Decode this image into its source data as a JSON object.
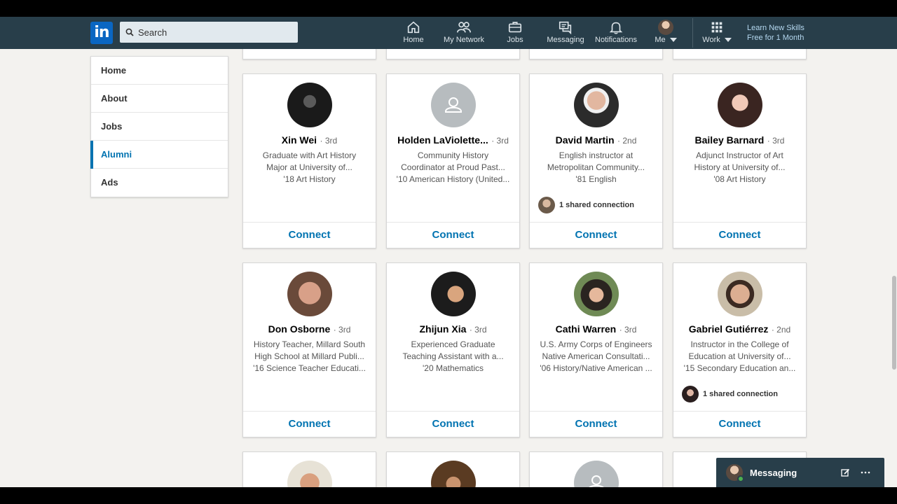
{
  "nav": {
    "search_placeholder": "Search",
    "items": [
      {
        "label": "Home",
        "icon": "home-icon"
      },
      {
        "label": "My Network",
        "icon": "network-icon"
      },
      {
        "label": "Jobs",
        "icon": "briefcase-icon"
      },
      {
        "label": "Messaging",
        "icon": "messaging-icon"
      },
      {
        "label": "Notifications",
        "icon": "bell-icon"
      },
      {
        "label": "Me",
        "icon": "avatar"
      },
      {
        "label": "Work",
        "icon": "grid-icon"
      }
    ],
    "promo_line1": "Learn New Skills",
    "promo_line2": "Free for 1 Month"
  },
  "sidebar": {
    "items": [
      {
        "label": "Home"
      },
      {
        "label": "About"
      },
      {
        "label": "Jobs"
      },
      {
        "label": "Alumni",
        "active": true
      },
      {
        "label": "Ads"
      }
    ]
  },
  "cards": [
    {
      "name": "Xin Wei",
      "degree": "· 3rd",
      "line1": "Graduate with Art History",
      "line2": "Major at University of...",
      "line3": "'18 Art History",
      "shared": "",
      "button": "Connect"
    },
    {
      "name": "Holden LaViolette...",
      "degree": "· 3rd",
      "line1": "Community History",
      "line2": "Coordinator at Proud Past...",
      "line3": "'10 American History (United...",
      "shared": "",
      "button": "Connect"
    },
    {
      "name": "David Martin",
      "degree": "· 2nd",
      "line1": "English instructor at",
      "line2": "Metropolitan Community...",
      "line3": "'81 English",
      "shared": "1 shared connection",
      "button": "Connect"
    },
    {
      "name": "Bailey Barnard",
      "degree": "· 3rd",
      "line1": "Adjunct Instructor of Art",
      "line2": "History at University of...",
      "line3": "'08 Art History",
      "shared": "",
      "button": "Connect"
    },
    {
      "name": "Don Osborne",
      "degree": "· 3rd",
      "line1": "History Teacher, Millard South",
      "line2": "High School at Millard Publi...",
      "line3": "'16 Science Teacher Educati...",
      "shared": "",
      "button": "Connect"
    },
    {
      "name": "Zhijun Xia",
      "degree": "· 3rd",
      "line1": "Experienced Graduate",
      "line2": "Teaching Assistant with a...",
      "line3": "'20 Mathematics",
      "shared": "",
      "button": "Connect"
    },
    {
      "name": "Cathi Warren",
      "degree": "· 3rd",
      "line1": "U.S. Army Corps of Engineers",
      "line2": "Native American Consultati...",
      "line3": "'06 History/Native American ...",
      "shared": "",
      "button": "Connect"
    },
    {
      "name": "Gabriel Gutiérrez",
      "degree": "· 2nd",
      "line1": "Instructor in the College of",
      "line2": "Education at University of...",
      "line3": "'15 Secondary Education an...",
      "shared": "1 shared connection",
      "button": "Connect"
    }
  ],
  "messaging": {
    "label": "Messaging"
  },
  "colors": {
    "nav_bg": "#283e4a",
    "accent": "#0073b1",
    "page_bg": "#f3f2ef"
  }
}
